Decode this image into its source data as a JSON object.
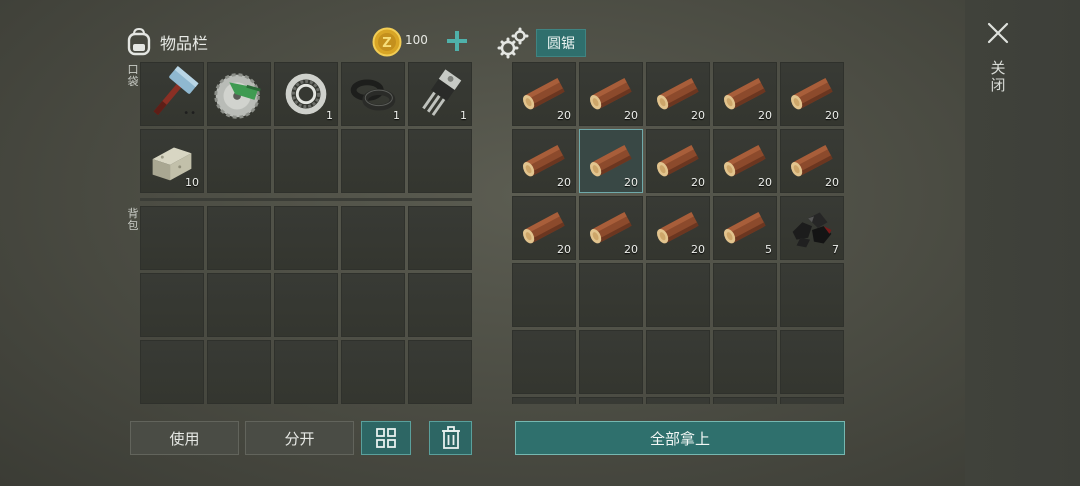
{
  "inventory": {
    "title": "物品栏",
    "coins": "100",
    "pocket_label": "口袋",
    "backpack_label": "背包",
    "pocket_slots": [
      {
        "item": "hammer-icon",
        "count": "",
        "dots": "••"
      },
      {
        "item": "saw-blade-icon",
        "count": ""
      },
      {
        "item": "bearing-icon",
        "count": "1"
      },
      {
        "item": "rubber-rings-icon",
        "count": "1"
      },
      {
        "item": "transistor-icon",
        "count": "1"
      },
      {
        "item": "stone-block-icon",
        "count": "10"
      },
      {
        "item": "",
        "count": ""
      },
      {
        "item": "",
        "count": ""
      },
      {
        "item": "",
        "count": ""
      },
      {
        "item": "",
        "count": ""
      }
    ],
    "backpack_slot_count": 15
  },
  "crafting": {
    "title": "圆锯",
    "slots": [
      {
        "item": "log-icon",
        "count": "20"
      },
      {
        "item": "log-icon",
        "count": "20"
      },
      {
        "item": "log-icon",
        "count": "20"
      },
      {
        "item": "log-icon",
        "count": "20"
      },
      {
        "item": "log-icon",
        "count": "20"
      },
      {
        "item": "log-icon",
        "count": "20"
      },
      {
        "item": "log-icon",
        "count": "20",
        "selected": true
      },
      {
        "item": "log-icon",
        "count": "20"
      },
      {
        "item": "log-icon",
        "count": "20"
      },
      {
        "item": "log-icon",
        "count": "20"
      },
      {
        "item": "log-icon",
        "count": "20"
      },
      {
        "item": "log-icon",
        "count": "20"
      },
      {
        "item": "log-icon",
        "count": "20"
      },
      {
        "item": "log-icon",
        "count": "5"
      },
      {
        "item": "coal-icon",
        "count": "7"
      }
    ],
    "total_slots": 30
  },
  "buttons": {
    "use": "使用",
    "split": "分开",
    "sort_icon": "grid-icon",
    "delete_icon": "trash-icon",
    "take_all": "全部拿上"
  },
  "close": {
    "label": "关闭"
  },
  "colors": {
    "accent_teal": "#2f706d",
    "slot_bg": "#383a35",
    "background": "#4a4b42"
  }
}
